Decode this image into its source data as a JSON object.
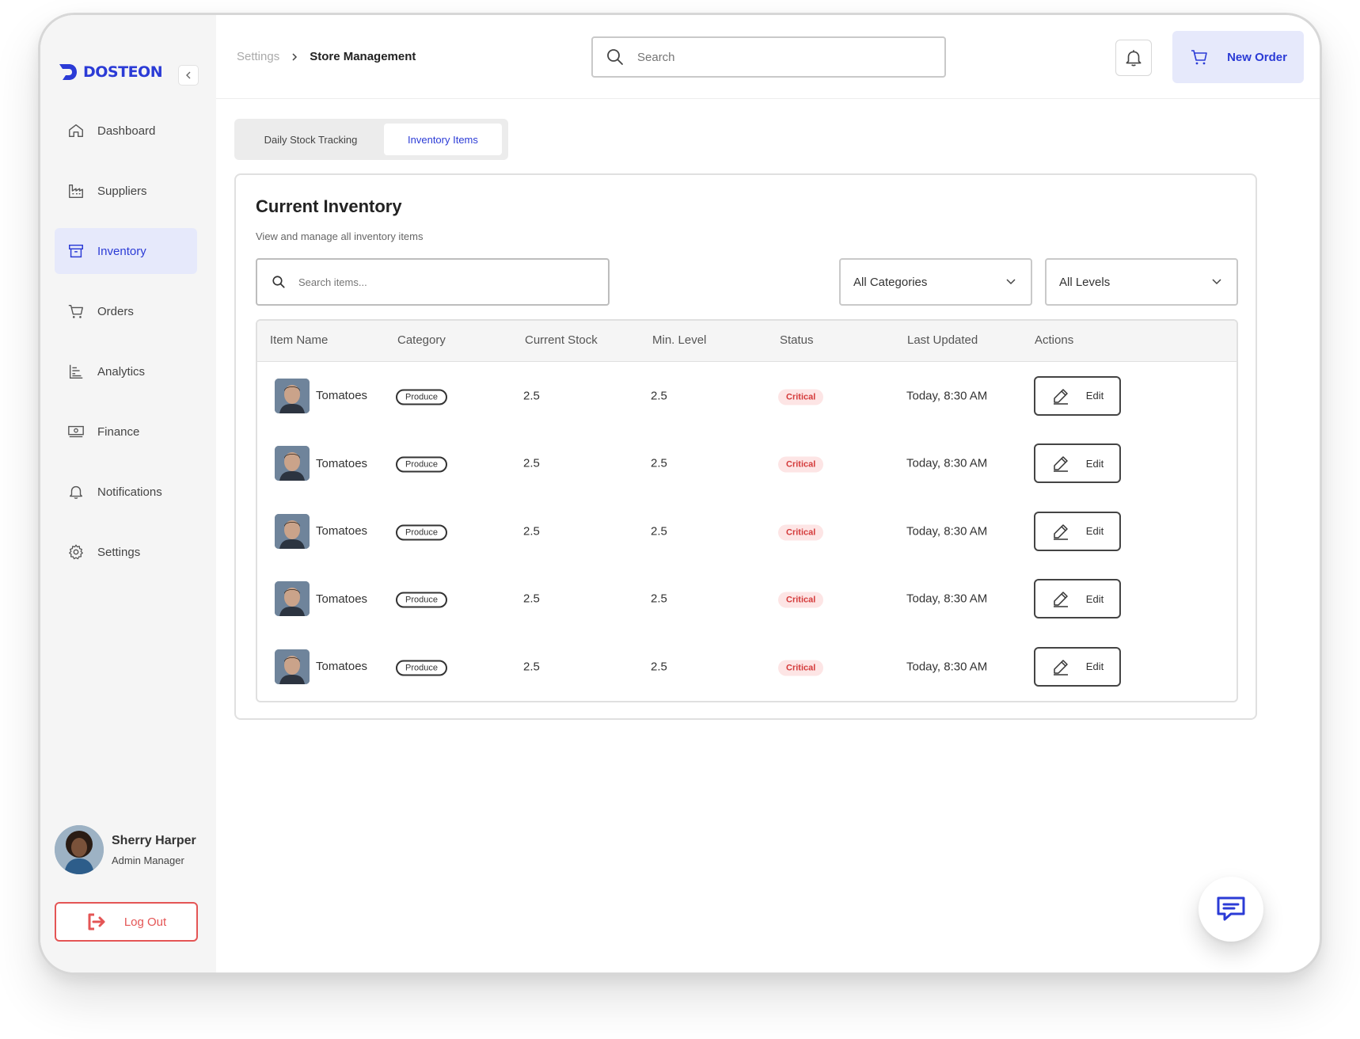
{
  "brand": {
    "name": "DOSTEON",
    "accent": "#2b3bd6"
  },
  "sidebar": {
    "items": [
      {
        "label": "Dashboard",
        "icon": "home-icon"
      },
      {
        "label": "Suppliers",
        "icon": "factory-icon"
      },
      {
        "label": "Inventory",
        "icon": "archive-box-icon",
        "active": true
      },
      {
        "label": "Orders",
        "icon": "cart-icon"
      },
      {
        "label": "Analytics",
        "icon": "bar-chart-icon"
      },
      {
        "label": "Finance",
        "icon": "cash-icon"
      },
      {
        "label": "Notifications",
        "icon": "bell-icon"
      },
      {
        "label": "Settings",
        "icon": "gear-icon"
      }
    ],
    "user": {
      "name": "Sherry Harper",
      "role": "Admin Manager"
    },
    "logout_label": "Log Out"
  },
  "header": {
    "breadcrumb": {
      "parent": "Settings",
      "current": "Store Management"
    },
    "search_placeholder": "Search",
    "new_order_label": "New Order"
  },
  "tabs": [
    {
      "label": "Daily Stock Tracking",
      "active": false
    },
    {
      "label": "Inventory Items",
      "active": true
    }
  ],
  "inventory": {
    "title": "Current Inventory",
    "subtitle": "View and manage all inventory items",
    "search_placeholder": "Search items...",
    "category_filter": "All Categories",
    "level_filter": "All Levels",
    "columns": [
      "Item Name",
      "Category",
      "Current Stock",
      "Min. Level",
      "Status",
      "Last Updated",
      "Actions"
    ],
    "edit_label": "Edit",
    "rows": [
      {
        "name": "Tomatoes",
        "category": "Produce",
        "stock": "2.5",
        "min": "2.5",
        "status": "Critical",
        "updated": "Today, 8:30 AM"
      },
      {
        "name": "Tomatoes",
        "category": "Produce",
        "stock": "2.5",
        "min": "2.5",
        "status": "Critical",
        "updated": "Today, 8:30 AM"
      },
      {
        "name": "Tomatoes",
        "category": "Produce",
        "stock": "2.5",
        "min": "2.5",
        "status": "Critical",
        "updated": "Today, 8:30 AM"
      },
      {
        "name": "Tomatoes",
        "category": "Produce",
        "stock": "2.5",
        "min": "2.5",
        "status": "Critical",
        "updated": "Today, 8:30 AM"
      },
      {
        "name": "Tomatoes",
        "category": "Produce",
        "stock": "2.5",
        "min": "2.5",
        "status": "Critical",
        "updated": "Today, 8:30 AM"
      }
    ]
  },
  "colors": {
    "critical": "#d43a3a",
    "logout": "#e45555",
    "active_bg": "#e6e9fb"
  }
}
